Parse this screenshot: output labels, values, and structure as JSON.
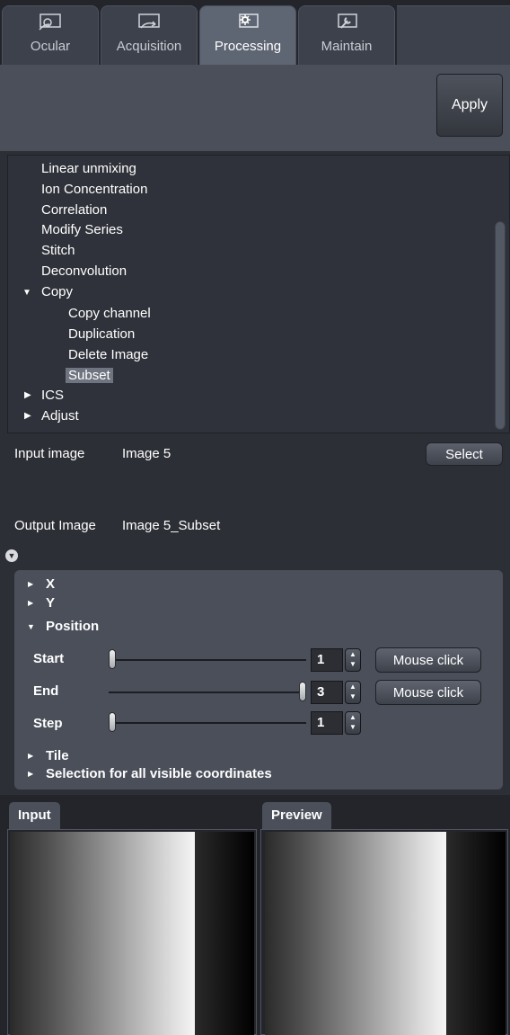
{
  "tabs": [
    {
      "label": "Ocular",
      "icon": "ocular-icon",
      "active": false
    },
    {
      "label": "Acquisition",
      "icon": "acquisition-icon",
      "active": false
    },
    {
      "label": "Processing",
      "icon": "gear-icon",
      "active": true
    },
    {
      "label": "Maintain",
      "icon": "wrench-icon",
      "active": false
    }
  ],
  "apply": {
    "label": "Apply"
  },
  "tree": {
    "items": [
      {
        "label": "Linear unmixing"
      },
      {
        "label": "Ion Concentration"
      },
      {
        "label": "Correlation"
      },
      {
        "label": "Modify Series"
      },
      {
        "label": "Stitch"
      },
      {
        "label": "Deconvolution"
      },
      {
        "label": "Copy",
        "expanded": true
      },
      {
        "label": "Copy channel"
      },
      {
        "label": "Duplication"
      },
      {
        "label": "Delete Image"
      },
      {
        "label": "Subset",
        "selected": true
      },
      {
        "label": "ICS",
        "expanded": false
      },
      {
        "label": "Adjust",
        "expanded": false
      }
    ]
  },
  "input": {
    "label": "Input image",
    "value": "Image 5",
    "select_label": "Select"
  },
  "output": {
    "label": "Output Image",
    "value": "Image 5_Subset"
  },
  "subset": {
    "x_label": "X",
    "y_label": "Y",
    "position_label": "Position",
    "rows": [
      {
        "label": "Start",
        "value": "1",
        "fraction": 0.0,
        "button": "Mouse click"
      },
      {
        "label": "End",
        "value": "3",
        "fraction": 1.0,
        "button": "Mouse click"
      },
      {
        "label": "Step",
        "value": "1",
        "fraction": 0.0
      }
    ],
    "tile_label": "Tile",
    "selection_label": "Selection for all visible coordinates"
  },
  "panes": {
    "input_label": "Input",
    "preview_label": "Preview"
  },
  "colors": {
    "background": "#2d2f36",
    "panel": "#4a4f5a",
    "active_tab": "#5e6573"
  }
}
